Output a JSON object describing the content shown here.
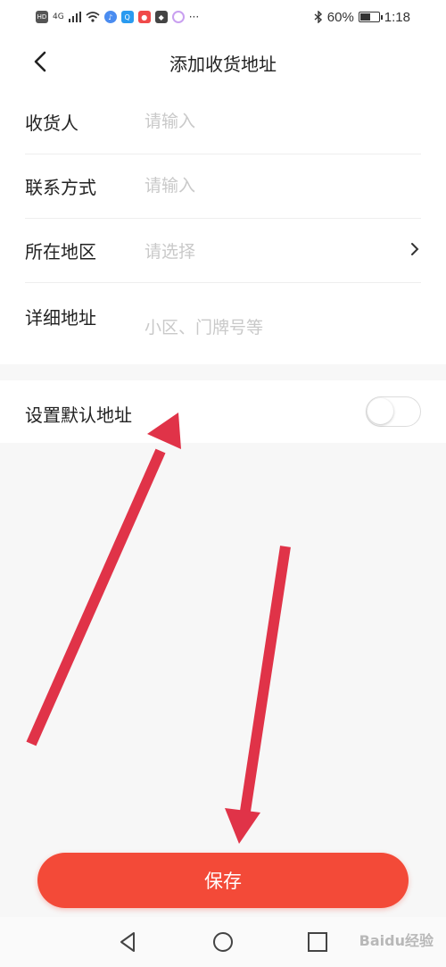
{
  "status_bar": {
    "network": "4G",
    "battery": "60%",
    "battery_level": 0.6,
    "time": "1:18",
    "more": "···"
  },
  "header": {
    "title": "添加收货地址"
  },
  "form": {
    "recipient": {
      "label": "收货人",
      "placeholder": "请输入"
    },
    "phone": {
      "label": "联系方式",
      "placeholder": "请输入"
    },
    "region": {
      "label": "所在地区",
      "placeholder": "请选择"
    },
    "address": {
      "label": "详细地址",
      "placeholder": "小区、门牌号等"
    }
  },
  "default_address": {
    "label": "设置默认地址",
    "enabled": false
  },
  "actions": {
    "save_label": "保存"
  },
  "colors": {
    "accent": "#f34a38",
    "annotation_arrow": "#e03348"
  },
  "watermark": "Baidu经验"
}
